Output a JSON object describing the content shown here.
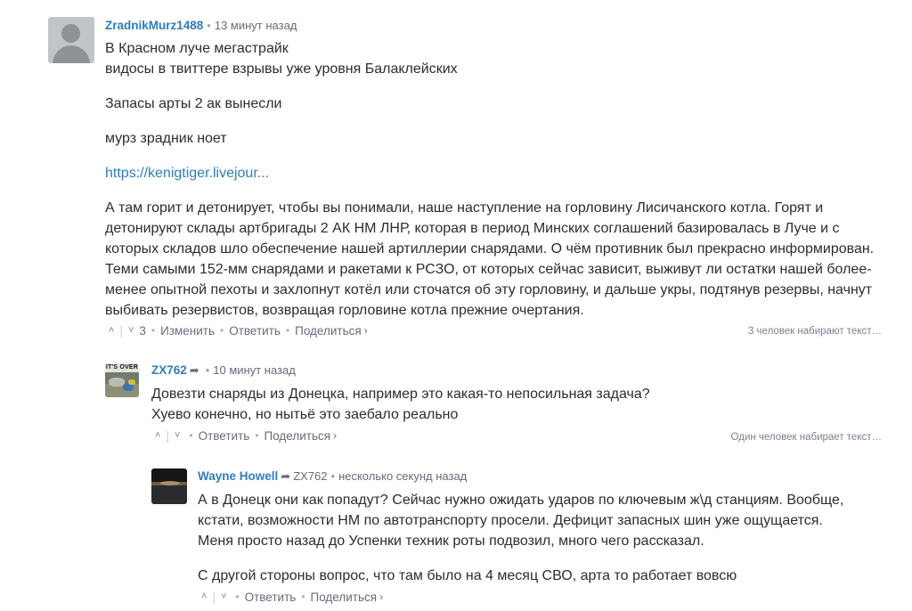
{
  "comments": [
    {
      "author": "ZradnikMurz1488",
      "time": "13 минут назад",
      "lines": [
        "В Красном луче мегастрайк",
        "видосы в твиттере взрывы уже уровня Балаклейских"
      ],
      "para2": "Запасы арты 2 ак вынесли",
      "para3": "мурз зрадник ноет",
      "link": "https://kenigtiger.livejour...",
      "para5": "А там горит и детонирует, чтобы вы понимали, наше наступление на горловину Лисичанского котла. Горят и детонируют склады артбригады 2 АК НМ ЛНР, которая в период Минских соглашений базировалась в Луче и с которых складов шло обеспечение нашей артиллерии снарядами. О чём противник был прекрасно информирован. Теми самыми 152-мм снарядами и ракетами к РСЗО, от которых сейчас зависит, выживут ли остатки нашей более-менее опытной пехоты и захлопнут котёл или сточатся об эту горловину, и дальше укры, подтянув резервы, начнут выбивать резервистов, возвращая горловине котла прежние очертания.",
      "votes": "3",
      "edit": "Изменить",
      "reply": "Ответить",
      "share": "Поделиться",
      "typing": "3 человек набирают текст…"
    },
    {
      "author": "ZX762",
      "avatar_caption": "IT'S OVER",
      "time": "10 минут назад",
      "line1": "Довезти снаряды из Донецка, например это какая-то непосильная задача?",
      "line2": "Хуево конечно, но нытьё это заебало реально",
      "reply": "Ответить",
      "share": "Поделиться",
      "typing": "Один человек набирает текст…"
    },
    {
      "author": "Wayne Howell",
      "reply_to": "ZX762",
      "time": "несколько секунд назад",
      "para1": "А в Донецк они как попадут? Сейчас нужно ожидать ударов по ключевым ж\\д станциям. Вообще, кстати, возможности НМ по автотранспорту просели. Дефицит запасных шин уже ощущается. Меня просто назад до Успенки техник роты подвозил, много чего рассказал.",
      "para2": "С другой стороны вопрос, что там было на 4 месяц СВО, арта то работает вовсю",
      "reply": "Ответить",
      "share": "Поделиться"
    }
  ]
}
